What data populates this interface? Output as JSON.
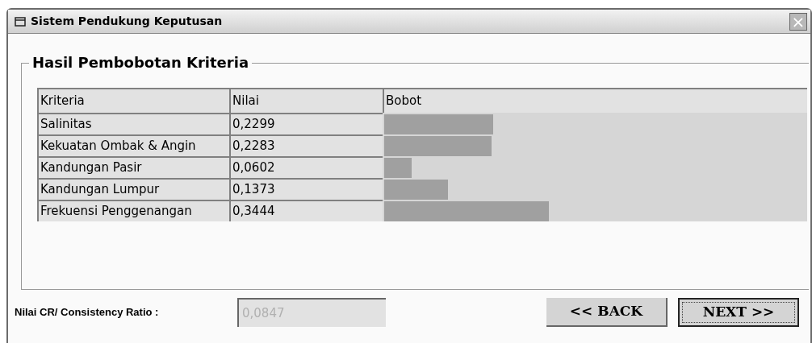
{
  "window": {
    "title": "Sistem Pendukung Keputusan",
    "close": "×"
  },
  "group": {
    "title": "Hasil Pembobotan Kriteria"
  },
  "table": {
    "columns": [
      "Kriteria",
      "Nilai",
      "Bobot"
    ],
    "rows": [
      {
        "kriteria": "Salinitas",
        "nilai": "0,2299",
        "level": 0.258
      },
      {
        "kriteria": "Kekuatan Ombak & Angin",
        "nilai": "0,2283",
        "level": 0.254
      },
      {
        "kriteria": "Kandungan Pasir",
        "nilai": "0,0602",
        "level": 0.064
      },
      {
        "kriteria": "Kandungan Lumpur",
        "nilai": "0,1373",
        "level": 0.151
      },
      {
        "kriteria": "Frekuensi Penggenangan",
        "nilai": "0,3444",
        "level": 0.389
      }
    ]
  },
  "cr": {
    "label": "Nilai CR/ Consistency Ratio :",
    "value": "0,0847"
  },
  "buttons": [
    {
      "label": "<< BACK",
      "selected": false
    },
    {
      "label": "NEXT >>",
      "selected": true
    }
  ]
}
